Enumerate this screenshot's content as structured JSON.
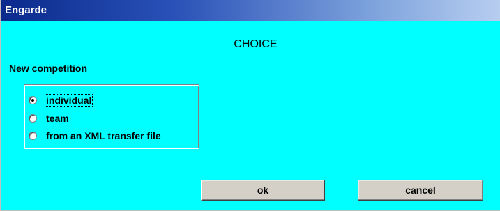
{
  "window": {
    "title": "Engarde",
    "background": "#00ffff",
    "titlebar_gradient": [
      "#0a2a8c",
      "#b8cef0"
    ]
  },
  "dialog": {
    "heading": "CHOICE",
    "section_label": "New competition",
    "options": [
      {
        "label": "individual",
        "selected": true
      },
      {
        "label": "team",
        "selected": false
      },
      {
        "label": "from an XML transfer file",
        "selected": false
      }
    ],
    "buttons": {
      "ok_label": "ok",
      "cancel_label": "cancel"
    }
  }
}
